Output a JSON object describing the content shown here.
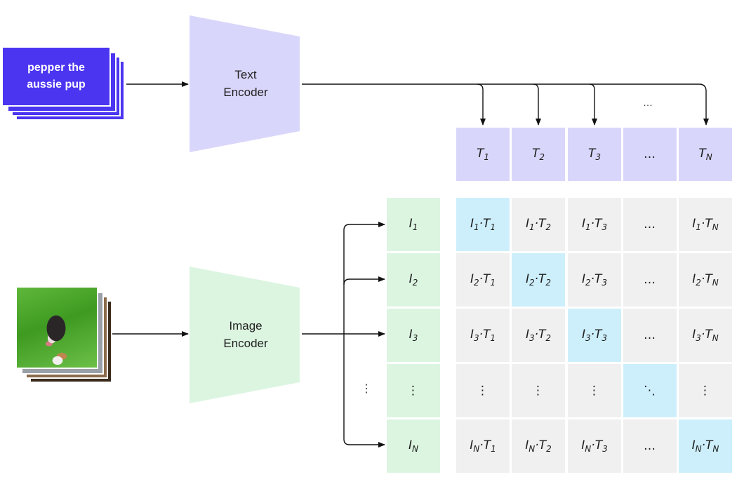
{
  "text_input": {
    "caption": "pepper the aussie pup",
    "line1": "pepper the",
    "line2": "aussie pup",
    "color": "#4b35f0"
  },
  "image_input": {
    "description": "photo of a puppy sitting on grass"
  },
  "text_encoder": {
    "line1": "Text",
    "line2": "Encoder",
    "color": "#d9d6fb"
  },
  "image_encoder": {
    "line1": "Image",
    "line2": "Encoder",
    "color": "#dcf5e1"
  },
  "text_embeddings": [
    {
      "base": "T",
      "sub": "1"
    },
    {
      "base": "T",
      "sub": "2"
    },
    {
      "base": "T",
      "sub": "3"
    },
    {
      "base": "…",
      "sub": ""
    },
    {
      "base": "T",
      "sub": "N"
    }
  ],
  "text_arrows_ellipsis": "…",
  "image_embeddings": [
    {
      "base": "I",
      "sub": "1"
    },
    {
      "base": "I",
      "sub": "2"
    },
    {
      "base": "I",
      "sub": "3"
    },
    {
      "base": "⋮",
      "sub": ""
    },
    {
      "base": "I",
      "sub": "N"
    }
  ],
  "image_arrows_ellipsis": "⋮",
  "matrix": {
    "diagonal_color": "#cdeffb",
    "offdiagonal_color": "#f0f0f1",
    "rows": [
      [
        "I1·T1",
        "I1·T2",
        "I1·T3",
        "…",
        "I1·TN"
      ],
      [
        "I2·T1",
        "I2·T2",
        "I2·T3",
        "…",
        "I2·TN"
      ],
      [
        "I3·T1",
        "I3·T2",
        "I3·T3",
        "…",
        "I3·TN"
      ],
      [
        "⋮",
        "⋮",
        "⋮",
        "⋱",
        "⋮"
      ],
      [
        "IN·T1",
        "IN·T2",
        "IN·T3",
        "…",
        "IN·TN"
      ]
    ],
    "diagonal": [
      [
        0,
        0
      ],
      [
        1,
        1
      ],
      [
        2,
        2
      ],
      [
        3,
        3
      ],
      [
        4,
        4
      ]
    ]
  }
}
